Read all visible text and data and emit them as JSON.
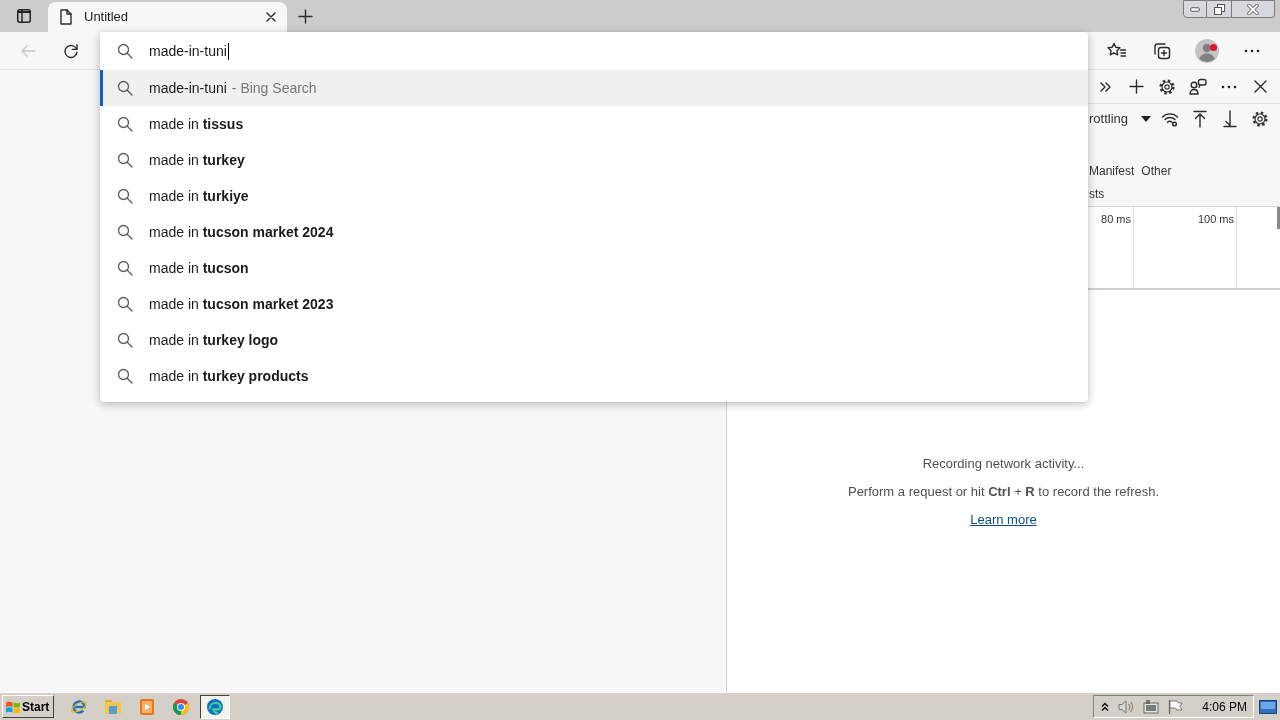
{
  "tab_strip": {
    "tabs": [
      {
        "title": "Untitled",
        "selected": true
      }
    ]
  },
  "address_bar": {
    "value": "made-in-tuni"
  },
  "suggestions": [
    {
      "text": "made-in-tuni",
      "hint": "- Bing Search",
      "selected": true
    },
    {
      "text": "made in **tissus**",
      "selected": false
    },
    {
      "text": "made in **turkey**",
      "selected": false
    },
    {
      "text": "made in **turkiye**",
      "selected": false
    },
    {
      "text": "made in **tucson market 2024**",
      "selected": false
    },
    {
      "text": "made in **tucson**",
      "selected": false
    },
    {
      "text": "made in **tucson market 2023**",
      "selected": false
    },
    {
      "text": "made in **turkey logo**",
      "selected": false
    },
    {
      "text": "made in **turkey products**",
      "selected": false
    }
  ],
  "devtools": {
    "throttling": "rottling",
    "filters": [
      "Manifest",
      "Other"
    ],
    "filter_label": "sts",
    "timeline_ticks": [
      "80 ms",
      "100 ms"
    ],
    "status": "Recording network activity...",
    "hint": "Perform a request or hit **Ctrl** + **R** to record the refresh.",
    "link": "Learn more"
  },
  "taskbar": {
    "start": "Start",
    "apps": [
      {
        "selected": false
      },
      {
        "selected": false
      },
      {
        "selected": false
      },
      {
        "selected": false
      },
      {
        "selected": true
      }
    ],
    "clock": "4:06 PM"
  }
}
